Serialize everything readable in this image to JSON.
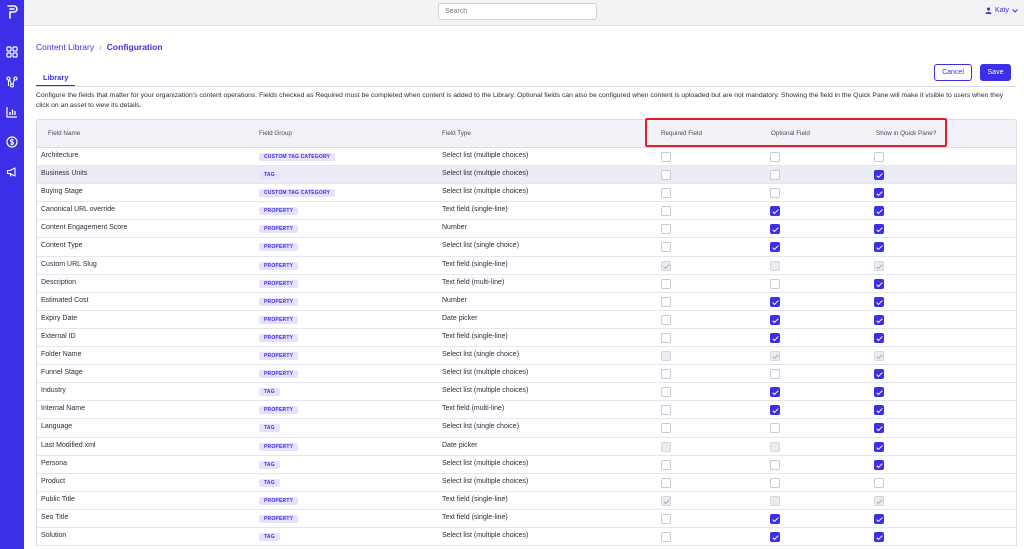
{
  "sidebar": {
    "logo": "brand-logo",
    "items": [
      {
        "icon": "grid-icon"
      },
      {
        "icon": "network-icon"
      },
      {
        "icon": "bar-chart-icon"
      },
      {
        "icon": "dollar-icon"
      },
      {
        "icon": "megaphone-icon"
      }
    ]
  },
  "topbar": {
    "search_placeholder": "Search",
    "user_name": "Katy",
    "user_icon": "person-icon"
  },
  "breadcrumb": {
    "parent": "Content Library",
    "separator": "›",
    "current": "Configuration"
  },
  "tabs": [
    {
      "label": "Library",
      "active": true
    }
  ],
  "actions": {
    "cancel": "Cancel",
    "save": "Save"
  },
  "description": "Configure the fields that matter for your organization's content operations. Fields checked as Required must be completed when content is added to the Library. Optional fields can also be configured when content is uploaded but are not mandatory. Showing the field in the Quick Pane will make it visible to users when they click on an asset to view its details.",
  "table": {
    "headers": {
      "name": "Field Name",
      "group": "Field Group",
      "type": "Field Type",
      "required": "Required Field",
      "optional": "Optional Field",
      "quickpane": "Show in Quick Pane?"
    },
    "colors": {
      "accent": "#3d2ee8",
      "highlight": "#e01f2a"
    },
    "rows": [
      {
        "name": "Architecture",
        "group": "CUSTOM TAG CATEGORY",
        "type": "Select list (multiple choices)",
        "required": "off",
        "optional": "off",
        "quickpane": "off"
      },
      {
        "name": "Business Units",
        "group": "TAG",
        "type": "Select list (multiple choices)",
        "required": "off",
        "optional": "off",
        "quickpane": "on"
      },
      {
        "name": "Buying Stage",
        "group": "CUSTOM TAG CATEGORY",
        "type": "Select list (multiple choices)",
        "required": "off",
        "optional": "off",
        "quickpane": "on"
      },
      {
        "name": "Canonical URL override",
        "group": "PROPERTY",
        "type": "Text field (single-line)",
        "required": "off",
        "optional": "on",
        "quickpane": "on"
      },
      {
        "name": "Content Engagement Score",
        "group": "PROPERTY",
        "type": "Number",
        "required": "off",
        "optional": "on",
        "quickpane": "on"
      },
      {
        "name": "Content Type",
        "group": "PROPERTY",
        "type": "Select list (single choice)",
        "required": "off",
        "optional": "on",
        "quickpane": "on"
      },
      {
        "name": "Custom URL Slug",
        "group": "PROPERTY",
        "type": "Text field (single-line)",
        "required": "disabled-on",
        "optional": "disabled",
        "quickpane": "disabled-on"
      },
      {
        "name": "Description",
        "group": "PROPERTY",
        "type": "Text field (multi-line)",
        "required": "off",
        "optional": "off",
        "quickpane": "on"
      },
      {
        "name": "Estimated Cost",
        "group": "PROPERTY",
        "type": "Number",
        "required": "off",
        "optional": "on",
        "quickpane": "on"
      },
      {
        "name": "Expiry Date",
        "group": "PROPERTY",
        "type": "Date picker",
        "required": "off",
        "optional": "on",
        "quickpane": "on"
      },
      {
        "name": "External ID",
        "group": "PROPERTY",
        "type": "Text field (single-line)",
        "required": "off",
        "optional": "on",
        "quickpane": "on"
      },
      {
        "name": "Folder Name",
        "group": "PROPERTY",
        "type": "Select list (single choice)",
        "required": "disabled",
        "optional": "disabled-on",
        "quickpane": "disabled-on"
      },
      {
        "name": "Funnel Stage",
        "group": "PROPERTY",
        "type": "Select list (multiple choices)",
        "required": "off",
        "optional": "off",
        "quickpane": "on"
      },
      {
        "name": "Industry",
        "group": "TAG",
        "type": "Select list (multiple choices)",
        "required": "off",
        "optional": "on",
        "quickpane": "on"
      },
      {
        "name": "Internal Name",
        "group": "PROPERTY",
        "type": "Text field (multi-line)",
        "required": "off",
        "optional": "on",
        "quickpane": "on"
      },
      {
        "name": "Language",
        "group": "TAG",
        "type": "Select list (single choice)",
        "required": "off",
        "optional": "off",
        "quickpane": "on"
      },
      {
        "name": "Last Modified.xml",
        "group": "PROPERTY",
        "type": "Date picker",
        "required": "disabled",
        "optional": "disabled",
        "quickpane": "on"
      },
      {
        "name": "Persona",
        "group": "TAG",
        "type": "Select list (multiple choices)",
        "required": "off",
        "optional": "off",
        "quickpane": "on"
      },
      {
        "name": "Product",
        "group": "TAG",
        "type": "Select list (multiple choices)",
        "required": "off",
        "optional": "off",
        "quickpane": "off"
      },
      {
        "name": "Public Title",
        "group": "PROPERTY",
        "type": "Text field (single-line)",
        "required": "disabled-on",
        "optional": "disabled",
        "quickpane": "disabled-on"
      },
      {
        "name": "Seo Title",
        "group": "PROPERTY",
        "type": "Text field (single-line)",
        "required": "off",
        "optional": "on",
        "quickpane": "on"
      },
      {
        "name": "Solution",
        "group": "TAG",
        "type": "Select list (multiple choices)",
        "required": "off",
        "optional": "on",
        "quickpane": "on"
      }
    ]
  }
}
